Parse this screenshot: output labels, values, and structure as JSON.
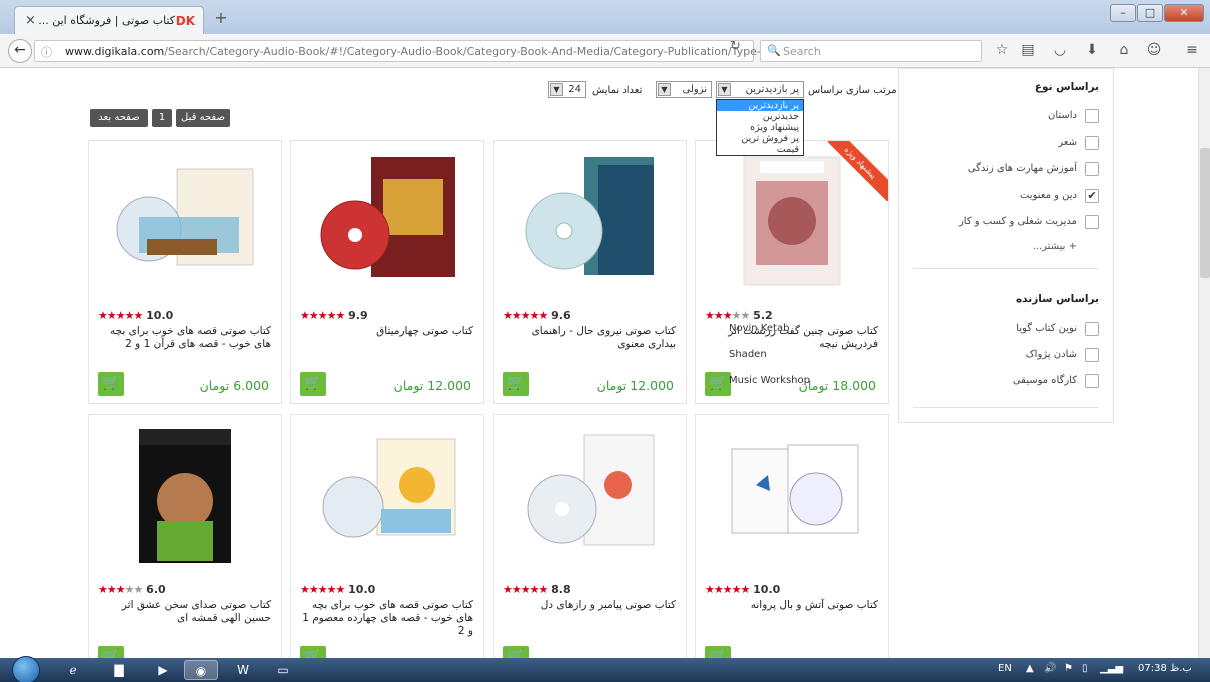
{
  "browser": {
    "tab_title": "کتاب صوتی | فروشگاه این ...",
    "tab_logo": "DK",
    "new_tab": "+",
    "url_domain": "www.digikala.com",
    "url_path": "/Search/Category-Audio-Book/#!/Category-Audio-Book/Category-Book-And-Media/Category-Publication/Type-252",
    "search_placeholder": "Search"
  },
  "sorting": {
    "sort_label": "مرتب سازی براساس",
    "sort_value": "پر بازدیدترین",
    "order_value": "نزولی",
    "count_label": "تعداد نمایش",
    "count_value": "24",
    "options": [
      "پر بازدیدترین",
      "جدیدترین",
      "پیشنهاد ویژه",
      "پر فروش ترین",
      "قیمت"
    ]
  },
  "pagination": {
    "prev": "صفحه قبل",
    "page": "1",
    "next": "صفحه بعد"
  },
  "products": [
    {
      "name": "کتاب صوتی چنین گفت زرتشت اثر فردریش نیچه",
      "rating": "5.2",
      "stars": 3,
      "price": "18.000 تومان",
      "badge": "پیشنهاد ویژه"
    },
    {
      "name": "کتاب صوتی نیروی حال - راهنمای بیداری معنوی",
      "rating": "9.6",
      "stars": 5,
      "price": "12.000 تومان"
    },
    {
      "name": "کتاب صوتی چهارمیثاق",
      "rating": "9.9",
      "stars": 5,
      "price": "12.000 تومان"
    },
    {
      "name": "کتاب صوتی قصه های خوب برای بچه های خوب - قصه های قرآن 1 و 2",
      "rating": "10.0",
      "stars": 5,
      "price": "6.000 تومان"
    },
    {
      "name": "کتاب صوتی آتش و بال پروانه",
      "rating": "10.0",
      "stars": 5,
      "price": ""
    },
    {
      "name": "کتاب صوتی پیامبر و رازهای دل",
      "rating": "8.8",
      "stars": 5,
      "price": ""
    },
    {
      "name": "کتاب صوتی قصه های خوب برای بچه های خوب - قصه های چهارده معصوم 1 و 2",
      "rating": "10.0",
      "stars": 5,
      "price": ""
    },
    {
      "name": "کتاب صوتی صدای سخن عشق اثر حسین الهی قمشه ای",
      "rating": "6.0",
      "stars": 3,
      "price": ""
    }
  ],
  "sidebar": {
    "type_heading": "براساس نوع",
    "types": [
      {
        "label": "داستان",
        "checked": false
      },
      {
        "label": "شعر",
        "checked": false
      },
      {
        "label": "آموزش مهارت های زندگی",
        "checked": false
      },
      {
        "label": "دین و معنویت",
        "checked": true
      },
      {
        "label": "مدیریت شغلی و کسب و کار",
        "checked": false
      }
    ],
    "more": "بیشتر...",
    "maker_heading": "براساس سازنده",
    "makers": [
      {
        "label": "نوین کتاب گویا",
        "en": "Novin Ketab"
      },
      {
        "label": "شادن پژواک",
        "en": "Shaden"
      },
      {
        "label": "کارگاه موسیقی",
        "en": "Music Workshop"
      }
    ]
  },
  "taskbar": {
    "lang": "EN",
    "time": "07:38 ب.ظ"
  }
}
